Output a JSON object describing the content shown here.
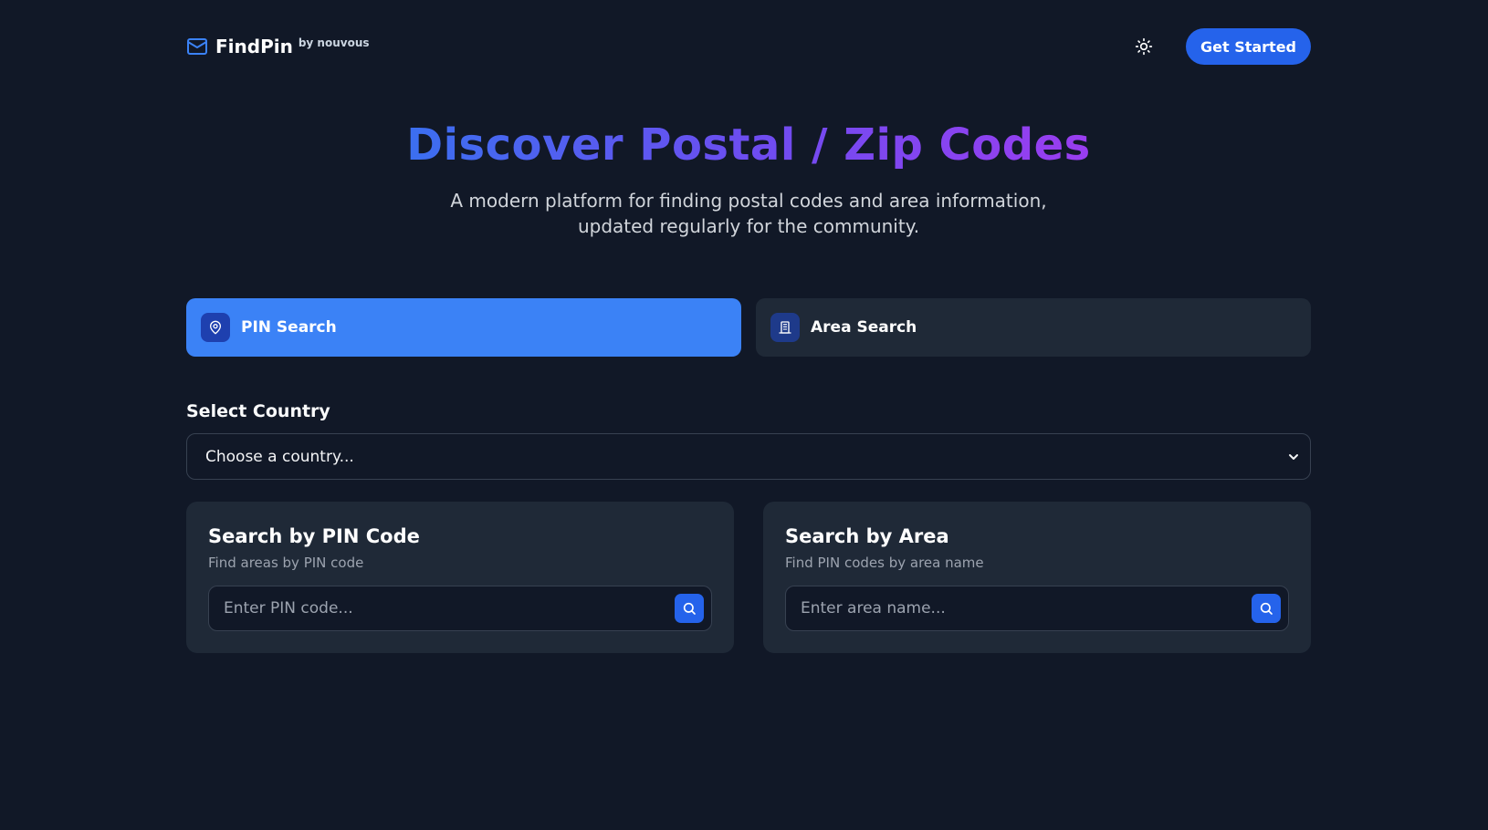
{
  "colors": {
    "background": "#111827",
    "accent": "#2563eb",
    "tab_active": "#3b82f6",
    "card": "#1f2937",
    "gradient_start": "#3b6ff0",
    "gradient_end": "#9a3df0"
  },
  "header": {
    "brand_name": "FindPin",
    "brand_by": "by nouvous",
    "brand_icon": "mail-icon",
    "theme_icon": "sun-icon",
    "cta_label": "Get Started"
  },
  "hero": {
    "title": "Discover Postal / Zip Codes",
    "subtitle_line1": "A modern platform for finding postal codes and area information,",
    "subtitle_line2": "updated regularly for the community."
  },
  "tabs": [
    {
      "label": "PIN Search",
      "icon": "map-pin-icon",
      "active": true
    },
    {
      "label": "Area Search",
      "icon": "building-icon",
      "active": false
    }
  ],
  "country": {
    "label": "Select Country",
    "selected": "Choose a country..."
  },
  "cards": {
    "pin": {
      "title": "Search by PIN Code",
      "subtitle": "Find areas by PIN code",
      "placeholder": "Enter PIN code...",
      "button_icon": "search-icon"
    },
    "area": {
      "title": "Search by Area",
      "subtitle": "Find PIN codes by area name",
      "placeholder": "Enter area name...",
      "button_icon": "search-icon"
    }
  }
}
